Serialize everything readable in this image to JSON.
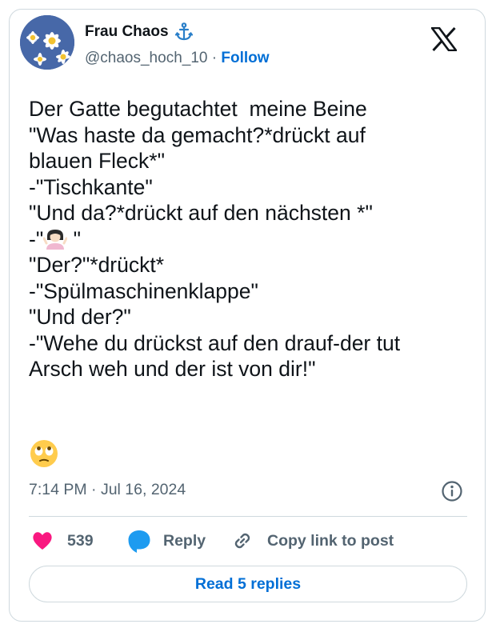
{
  "author": {
    "display_name": "Frau Chaos",
    "name_emoji_icon": "anchor-icon",
    "handle": "@chaos_hoch_10",
    "separator": "·",
    "follow_label": "Follow",
    "avatar_icon": "daisy-flowers-avatar"
  },
  "brand": {
    "logo_icon": "x-logo-icon"
  },
  "tweet": {
    "lines": [
      "Der Gatte begutachtet  meine Beine",
      "\"Was haste da gemacht?*drückt auf",
      "blauen Fleck*\"",
      "-\"Tischkante\"",
      "\"Und da?*drückt auf den nächsten *\"",
      "-\"",
      "\"Der?\"*drückt*",
      "-\"Spülmaschinenklappe\"",
      "\"Und der?\"",
      "-\"Wehe du drückst auf den drauf-der tut",
      "Arsch weh und der ist von dir!\""
    ],
    "shrug_line_suffix": " \"",
    "shrug_emoji_icon": "woman-shrugging-emoji",
    "trailing_emoji_icon": "face-with-rolling-eyes-emoji",
    "timestamp": "7:14 PM · Jul 16, 2024",
    "info_icon": "info-icon"
  },
  "actions": {
    "like_count": "539",
    "like_icon": "heart-icon",
    "reply_label": "Reply",
    "reply_icon": "speech-bubble-icon",
    "copy_label": "Copy link to post",
    "copy_icon": "link-icon"
  },
  "footer": {
    "read_replies_label": "Read 5 replies"
  },
  "colors": {
    "text_primary": "#0f1419",
    "text_secondary": "#536471",
    "accent_blue": "#006fd6",
    "like_pink": "#f91880",
    "border": "#cfd9de"
  }
}
